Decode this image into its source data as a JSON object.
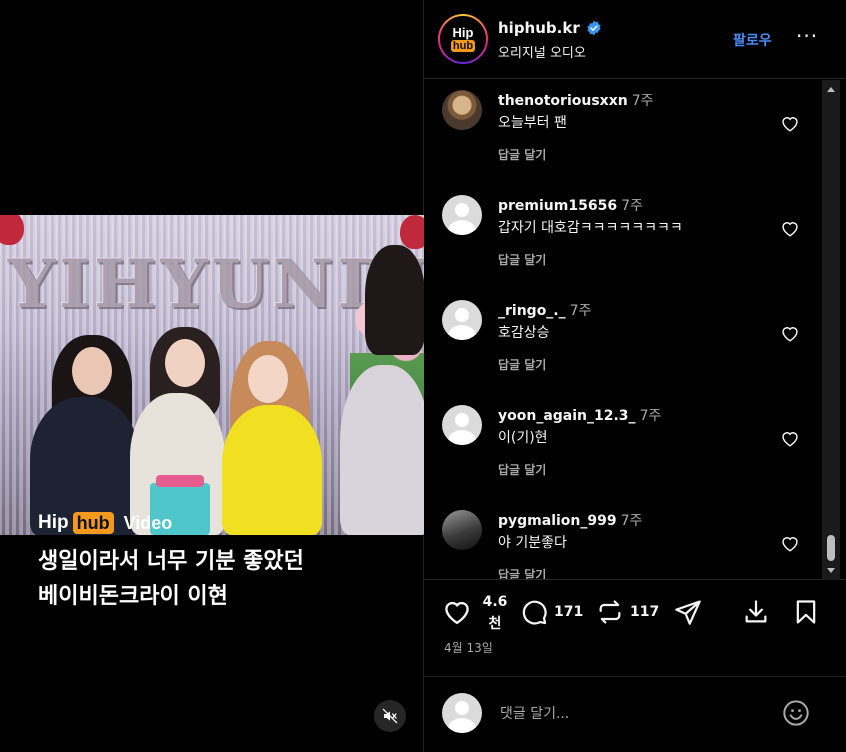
{
  "video": {
    "brand_hip": "Hip",
    "brand_hub": "hub",
    "brand_video": "Video",
    "caption_line1": "생일이라서 너무 기분 좋았던",
    "caption_line2": "베이비돈크라이 이현",
    "backdrop_text": "YIHYUNDI",
    "mute_icon": "speaker-muted-icon"
  },
  "header": {
    "avatar_hip": "Hip",
    "avatar_hub": "hub",
    "username": "hiphub.kr",
    "verified_icon": "verified-badge-icon",
    "subtitle": "오리지널 오디오",
    "follow_label": "팔로우",
    "more_label": "···"
  },
  "comments": [
    {
      "user": "thenotoriousxxn",
      "time": "7주",
      "text": "오늘부터 팬",
      "reply": "답글 달기",
      "avatar": "photo"
    },
    {
      "user": "premium15656",
      "time": "7주",
      "text": "갑자기 대호감ㅋㅋㅋㅋㅋㅋㅋㅋ",
      "reply": "답글 달기",
      "avatar": "default"
    },
    {
      "user": "_ringo_._",
      "time": "7주",
      "text": "호감상승",
      "reply": "답글 달기",
      "avatar": "default"
    },
    {
      "user": "yoon_again_12.3_",
      "time": "7주",
      "text": "이(기)현",
      "reply": "답글 달기",
      "avatar": "default"
    },
    {
      "user": "pygmalion_999",
      "time": "7주",
      "text": "야 기분좋다",
      "reply": "답글 달기",
      "avatar": "photo"
    }
  ],
  "actions": {
    "like_count_line1": "4.6",
    "like_count_line2": "천",
    "comment_count": "171",
    "repost_count": "117",
    "date": "4월 13일"
  },
  "add_comment": {
    "placeholder": "댓글 달기..."
  },
  "colors": {
    "background": "#000000",
    "accent_blue": "#4a8bf5",
    "brand_orange": "#f39a1e",
    "secondary_text": "#a8a8a8"
  }
}
